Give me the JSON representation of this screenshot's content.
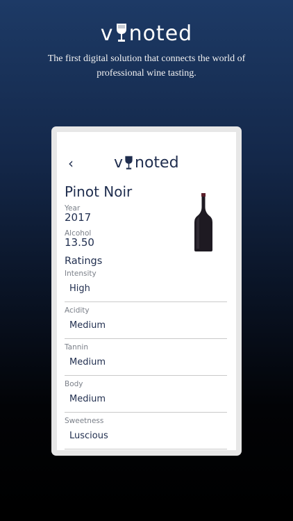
{
  "brand": {
    "pre": "v",
    "post": "noted"
  },
  "tagline": "The first digital solution that connects the world of professional wine tasting.",
  "app": {
    "logo_pre": "v",
    "logo_post": "noted",
    "back_symbol": "‹"
  },
  "wine": {
    "name": "Pinot Noir",
    "year_label": "Year",
    "year": "2017",
    "alcohol_label": "Alcohol",
    "alcohol": "13.50"
  },
  "ratings": {
    "title": "Ratings",
    "items": [
      {
        "label": "Intensity",
        "value": "High"
      },
      {
        "label": "Acidity",
        "value": "Medium"
      },
      {
        "label": "Tannin",
        "value": "Medium"
      },
      {
        "label": "Body",
        "value": "Medium"
      },
      {
        "label": "Sweetness",
        "value": "Luscious"
      }
    ]
  },
  "colors": {
    "brand_navy": "#1f2d4e",
    "bottle": "#1e1a22"
  }
}
